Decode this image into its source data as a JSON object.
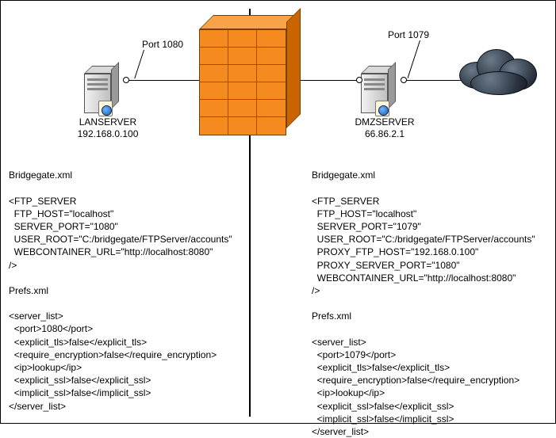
{
  "left": {
    "port_label": "Port 1080",
    "server_name": "LANSERVER",
    "server_ip": "192.168.0.100",
    "bridgegate_file": "Bridgegate.xml",
    "prefs_file": "Prefs.xml",
    "ftp": {
      "tag_open": "<FTP_SERVER",
      "host": "  FTP_HOST=\"localhost\"",
      "port": "  SERVER_PORT=\"1080\"",
      "root": "  USER_ROOT=\"C:/bridgegate/FTPServer/accounts\"",
      "web": "  WEBCONTAINER_URL=\"http://localhost:8080\"",
      "close": "/>"
    },
    "prefs": {
      "open": "<server_list>",
      "port": "  <port>1080</port>",
      "etls": "  <explicit_tls>false</explicit_tls>",
      "renc": "  <require_encryption>false</require_encryption>",
      "ip": "  <ip>lookup</ip>",
      "essl": "  <explicit_ssl>false</explicit_ssl>",
      "issl": "  <implicit_ssl>false</implicit_ssl>",
      "close": "</server_list>"
    }
  },
  "right": {
    "port_label": "Port 1079",
    "server_name": "DMZSERVER",
    "server_ip": "66.86.2.1",
    "bridgegate_file": "Bridgegate.xml",
    "prefs_file": "Prefs.xml",
    "ftp": {
      "tag_open": "<FTP_SERVER",
      "host": "  FTP_HOST=\"localhost\"",
      "port": "  SERVER_PORT=\"1079\"",
      "root": "  USER_ROOT=\"C:/bridgegate/FTPServer/accounts\"",
      "phost": "  PROXY_FTP_HOST=\"192.168.0.100\"",
      "pport": "  PROXY_SERVER_PORT=\"1080\"",
      "web": "  WEBCONTAINER_URL=\"http://localhost:8080\"",
      "close": "/>"
    },
    "prefs": {
      "open": "<server_list>",
      "port": "  <port>1079</port>",
      "etls": "  <explicit_tls>false</explicit_tls>",
      "renc": "  <require_encryption>false</require_encryption>",
      "ip": "  <ip>lookup</ip>",
      "essl": "  <explicit_ssl>false</explicit_ssl>",
      "issl": "  <implicit_ssl>false</implicit_ssl>",
      "close": "</server_list>"
    }
  }
}
